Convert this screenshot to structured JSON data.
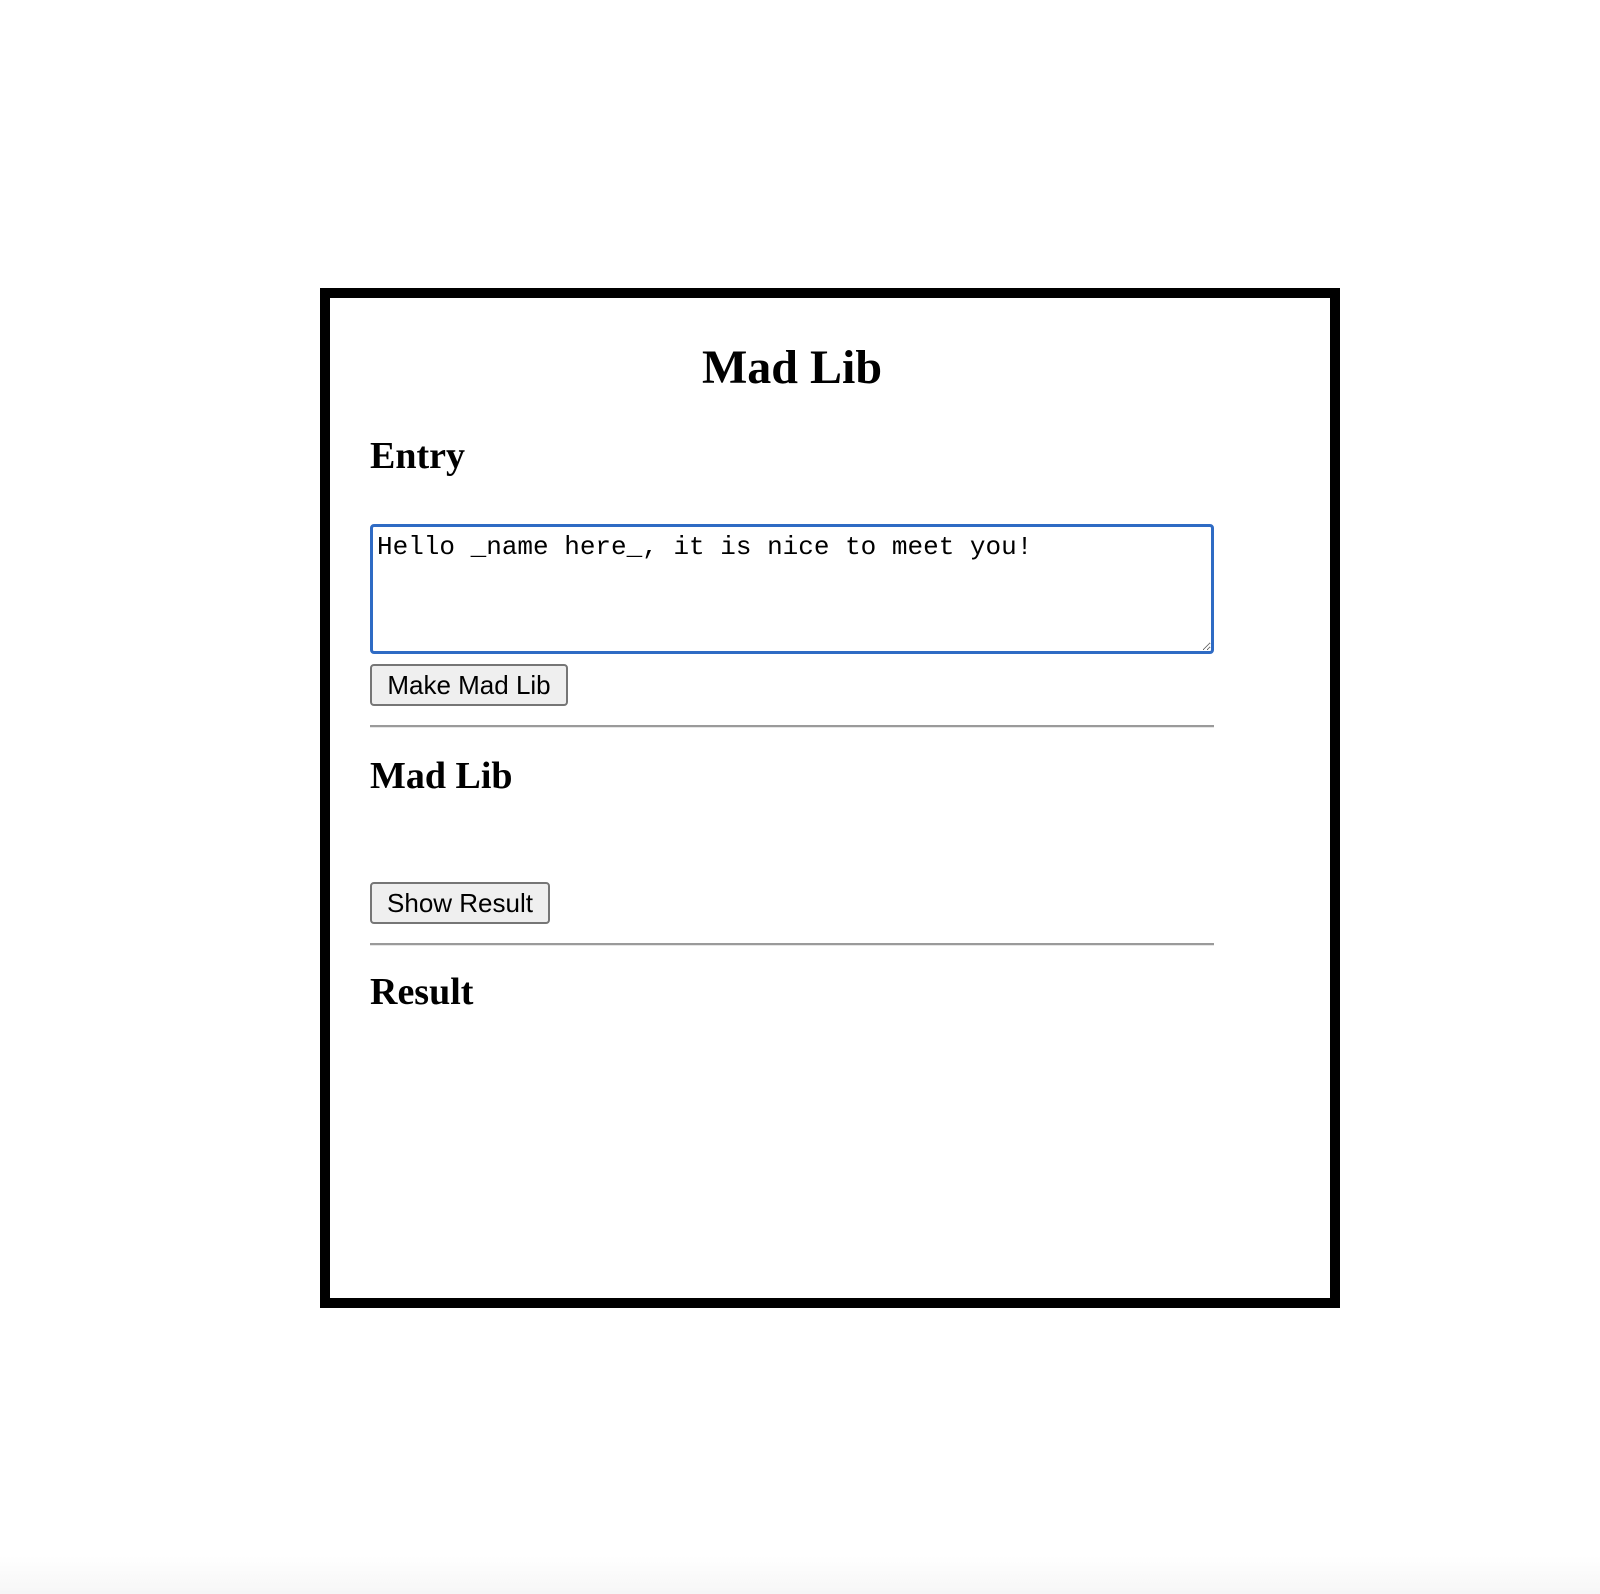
{
  "page": {
    "title": "Mad Lib"
  },
  "entry": {
    "heading": "Entry",
    "textarea_value": "Hello _name here_, it is nice to meet you!",
    "make_button_label": "Make Mad Lib"
  },
  "madlib": {
    "heading": "Mad Lib",
    "output_text": "",
    "show_button_label": "Show Result"
  },
  "result": {
    "heading": "Result",
    "output_text": ""
  },
  "colors": {
    "border": "#000000",
    "textarea_focus": "#2f6bc4",
    "button_bg": "#efefef",
    "divider": "#9a9a9a"
  }
}
